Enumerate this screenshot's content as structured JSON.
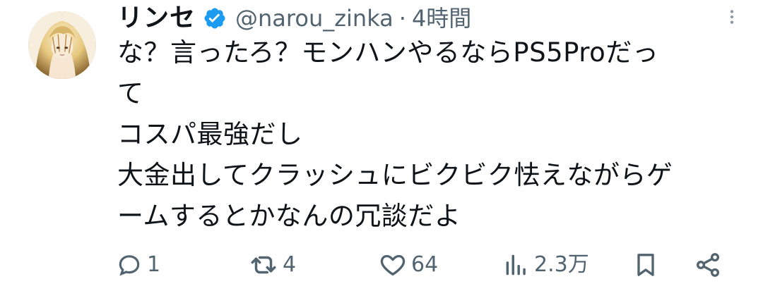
{
  "author": {
    "display_name": "リンセ",
    "handle": "@narou_zinka",
    "separator": "·",
    "time": "4時間",
    "verified": true
  },
  "tweet": {
    "text": "な？言ったろ？モンハンやるならPS5Proだっ\nて\nコスパ最強だし\n大金出してクラッシュにビクビク怯えながらゲ\nームするとかなんの冗談だよ"
  },
  "actions": {
    "reply_count": "1",
    "retweet_count": "4",
    "like_count": "64",
    "views_count": "2.3万"
  },
  "icons": {
    "verified": "verified-badge-icon",
    "more": "more-vertical-icon",
    "reply": "reply-icon",
    "retweet": "retweet-icon",
    "like": "heart-icon",
    "views": "views-bar-chart-icon",
    "bookmark": "bookmark-icon",
    "share": "share-icon"
  },
  "colors": {
    "text_primary": "#0f1419",
    "text_secondary": "#536471",
    "verified_blue": "#1d9bf0",
    "background": "#ffffff"
  }
}
